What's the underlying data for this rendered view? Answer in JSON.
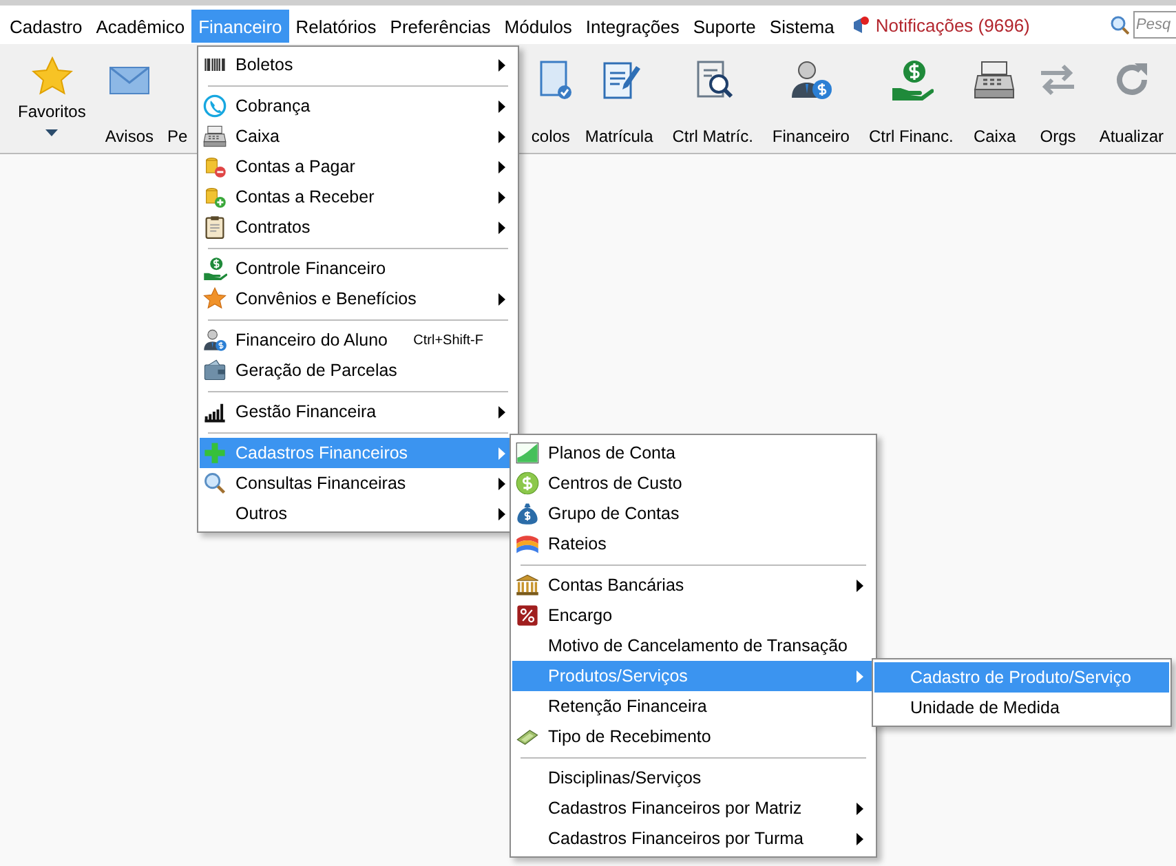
{
  "menu_bar": {
    "items": [
      {
        "label": "Cadastro",
        "selected": false
      },
      {
        "label": "Acadêmico",
        "selected": false
      },
      {
        "label": "Financeiro",
        "selected": true
      },
      {
        "label": "Relatórios",
        "selected": false
      },
      {
        "label": "Preferências",
        "selected": false
      },
      {
        "label": "Módulos",
        "selected": false
      },
      {
        "label": "Integrações",
        "selected": false
      },
      {
        "label": "Suporte",
        "selected": false
      },
      {
        "label": "Sistema",
        "selected": false
      }
    ],
    "notifications": "Notificações (9696)",
    "search": {
      "placeholder": "Pesq"
    }
  },
  "toolbar": {
    "items": [
      {
        "label": "Favoritos",
        "has_dropdown": true
      },
      {
        "label": "Avisos",
        "has_dropdown": false
      },
      {
        "label": "Pe",
        "has_dropdown": false
      },
      {
        "label": "colos",
        "has_dropdown": false
      },
      {
        "label": "Matrícula",
        "has_dropdown": false
      },
      {
        "label": "Ctrl Matríc.",
        "has_dropdown": false
      },
      {
        "label": "Financeiro",
        "has_dropdown": false
      },
      {
        "label": "Ctrl Financ.",
        "has_dropdown": false
      },
      {
        "label": "Caixa",
        "has_dropdown": false
      },
      {
        "label": "Orgs",
        "has_dropdown": false
      },
      {
        "label": "Atualizar",
        "has_dropdown": false
      }
    ]
  },
  "financeiro_menu": {
    "groups": [
      {
        "items": [
          {
            "label": "Boletos",
            "has_submenu": true,
            "selected": false
          }
        ]
      },
      {
        "items": [
          {
            "label": "Cobrança",
            "has_submenu": true,
            "selected": false
          },
          {
            "label": "Caixa",
            "has_submenu": true,
            "selected": false
          },
          {
            "label": "Contas a Pagar",
            "has_submenu": true,
            "selected": false
          },
          {
            "label": "Contas a Receber",
            "has_submenu": true,
            "selected": false
          },
          {
            "label": "Contratos",
            "has_submenu": true,
            "selected": false
          }
        ]
      },
      {
        "items": [
          {
            "label": "Controle Financeiro",
            "has_submenu": false,
            "selected": false
          },
          {
            "label": "Convênios e Benefícios",
            "has_submenu": true,
            "selected": false
          }
        ]
      },
      {
        "items": [
          {
            "label": "Financeiro do Aluno",
            "shortcut": "Ctrl+Shift-F",
            "has_submenu": false,
            "selected": false
          },
          {
            "label": "Geração de Parcelas",
            "has_submenu": false,
            "selected": false
          }
        ]
      },
      {
        "items": [
          {
            "label": "Gestão Financeira",
            "has_submenu": true,
            "selected": false
          }
        ]
      },
      {
        "items": [
          {
            "label": "Cadastros Financeiros",
            "has_submenu": true,
            "selected": true
          },
          {
            "label": "Consultas Financeiras",
            "has_submenu": true,
            "selected": false
          },
          {
            "label": "Outros",
            "has_submenu": true,
            "selected": false
          }
        ]
      }
    ]
  },
  "cadastros_financeiros_submenu": {
    "groups": [
      {
        "items": [
          {
            "label": "Planos de Conta",
            "has_submenu": false,
            "selected": false
          },
          {
            "label": "Centros de Custo",
            "has_submenu": false,
            "selected": false
          },
          {
            "label": "Grupo de Contas",
            "has_submenu": false,
            "selected": false
          },
          {
            "label": "Rateios",
            "has_submenu": false,
            "selected": false
          }
        ]
      },
      {
        "items": [
          {
            "label": "Contas Bancárias",
            "has_submenu": true,
            "selected": false
          },
          {
            "label": "Encargo",
            "has_submenu": false,
            "selected": false
          },
          {
            "label": "Motivo de Cancelamento de Transação",
            "has_submenu": false,
            "selected": false
          },
          {
            "label": "Produtos/Serviços",
            "has_submenu": true,
            "selected": true
          },
          {
            "label": "Retenção Financeira",
            "has_submenu": false,
            "selected": false
          },
          {
            "label": "Tipo de Recebimento",
            "has_submenu": false,
            "selected": false
          }
        ]
      },
      {
        "items": [
          {
            "label": "Disciplinas/Serviços",
            "has_submenu": false,
            "selected": false
          },
          {
            "label": "Cadastros Financeiros por Matriz",
            "has_submenu": true,
            "selected": false
          },
          {
            "label": "Cadastros Financeiros por Turma",
            "has_submenu": true,
            "selected": false
          }
        ]
      }
    ]
  },
  "produtos_servicos_submenu": {
    "groups": [
      {
        "items": [
          {
            "label": "Cadastro de Produto/Serviço",
            "has_submenu": false,
            "selected": true
          },
          {
            "label": "Unidade de Medida",
            "has_submenu": false,
            "selected": false
          }
        ]
      }
    ]
  }
}
